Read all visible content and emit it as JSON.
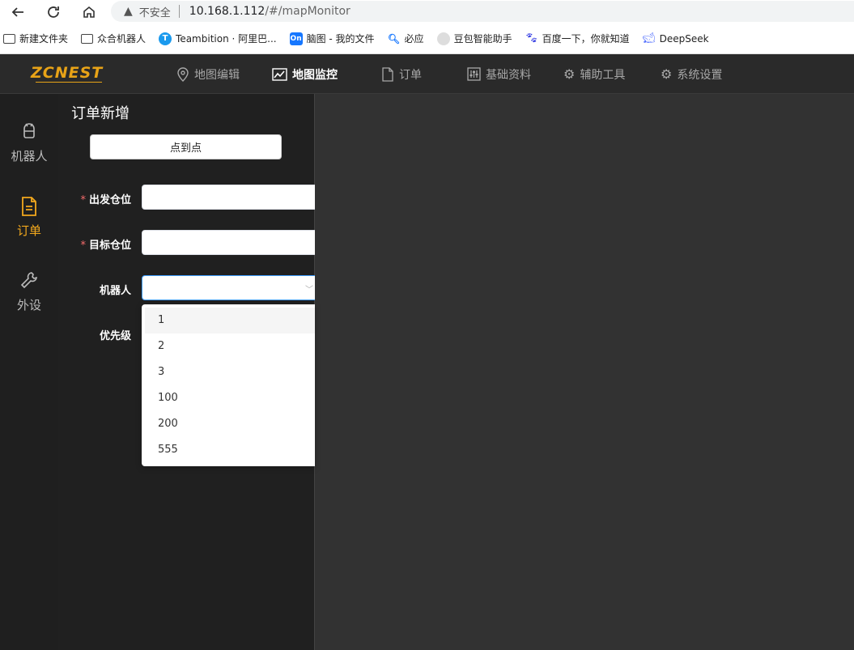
{
  "browser": {
    "insecure_label": "不安全",
    "url_host": "10.168.1.112",
    "url_path": "/#/mapMonitor",
    "bookmarks": [
      {
        "label": "新建文件夹",
        "icon": "folder-icon"
      },
      {
        "label": "众合机器人",
        "icon": "folder-icon"
      },
      {
        "label": "Teambition · 阿里巴...",
        "icon": "teambition-icon"
      },
      {
        "label": "脑图 - 我的文件",
        "icon": "on-icon"
      },
      {
        "label": "必应",
        "icon": "bing-icon"
      },
      {
        "label": "豆包智能助手",
        "icon": "doubao-icon"
      },
      {
        "label": "百度一下，你就知道",
        "icon": "baidu-icon"
      },
      {
        "label": "DeepSeek",
        "icon": "deepseek-icon"
      }
    ]
  },
  "app": {
    "logo": "ZCNEST",
    "nav": [
      {
        "label": "地图编辑",
        "icon": "map-pin-icon"
      },
      {
        "label": "地图监控",
        "icon": "chart-line-icon",
        "active": true
      },
      {
        "label": "订单",
        "icon": "file-icon"
      },
      {
        "label": "基础资料",
        "icon": "sliders-icon"
      },
      {
        "label": "辅助工具",
        "icon": "gear-icon"
      },
      {
        "label": "系统设置",
        "icon": "gear-icon"
      }
    ],
    "rail": [
      {
        "label": "机器人",
        "icon": "android-icon"
      },
      {
        "label": "订单",
        "icon": "document-icon",
        "active": true
      },
      {
        "label": "外设",
        "icon": "wrench-icon"
      }
    ]
  },
  "order_form": {
    "title": "订单新增",
    "mode_button": "点到点",
    "fields": {
      "from_label": "出发仓位",
      "from_value": "",
      "to_label": "目标仓位",
      "to_value": "",
      "robot_label": "机器人",
      "robot_value": "",
      "priority_label": "优先级"
    },
    "required_mark": "*",
    "robot_options": [
      "1",
      "2",
      "3",
      "100",
      "200",
      "555"
    ]
  },
  "colors": {
    "accent": "#f2a81d",
    "required": "#f56c6c",
    "focus": "#409eff"
  }
}
